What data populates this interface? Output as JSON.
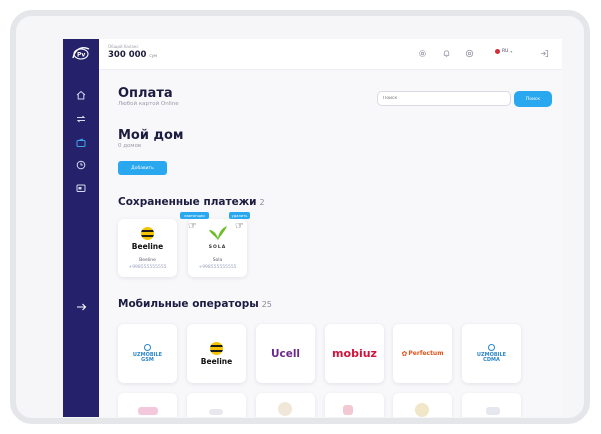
{
  "topbar": {
    "balance_label": "Общий баланс",
    "balance_value": "300 000",
    "balance_unit": "сум",
    "language": "RU",
    "icons": [
      "gear-icon",
      "bell-icon",
      "settings-icon",
      "flag-icon",
      "logout-icon"
    ]
  },
  "sidebar": {
    "items": [
      {
        "icon": "home-icon"
      },
      {
        "icon": "transfer-icon"
      },
      {
        "icon": "wallet-icon",
        "active": true
      },
      {
        "icon": "history-icon"
      },
      {
        "icon": "card-icon"
      },
      {
        "icon": "arrow-right-icon"
      }
    ]
  },
  "page": {
    "title": "Оплата",
    "subtitle": "Любой картой Online",
    "search_placeholder": "Поиск",
    "search_button": "Поиск"
  },
  "home": {
    "title": "Мой дом",
    "subtitle": "0 домов",
    "add_button": "Добавить"
  },
  "saved": {
    "title": "Сохраненные платежи",
    "count": "2",
    "receipt_tag": "квитанции",
    "delete_tag": "удалить",
    "items": [
      {
        "name": "Beeline",
        "phone": "+998555555555",
        "logo": "Beeline"
      },
      {
        "name": "Sola",
        "phone": "+998555555555",
        "logo": "SOLA"
      }
    ]
  },
  "operators": {
    "title": "Мобильные операторы",
    "count": "25",
    "items": [
      {
        "name": "UZMOBILE GSM",
        "line1": "UZMOBILE",
        "line2": "GSM"
      },
      {
        "name": "Beeline",
        "line1": "Beeline"
      },
      {
        "name": "Ucell",
        "line1": "Ucell"
      },
      {
        "name": "mobiuz",
        "line1": "mobiuz"
      },
      {
        "name": "Perfectum",
        "line1": "Perfectum"
      },
      {
        "name": "UZMOBILE CDMA",
        "line1": "UZMOBILE",
        "line2": "CDMA"
      }
    ]
  },
  "colors": {
    "sidebar": "#25216b",
    "accent": "#2aa8ef",
    "ucell": "#6b2a8a",
    "mobiuz": "#d1143c",
    "perfectum": "#e2531a"
  }
}
